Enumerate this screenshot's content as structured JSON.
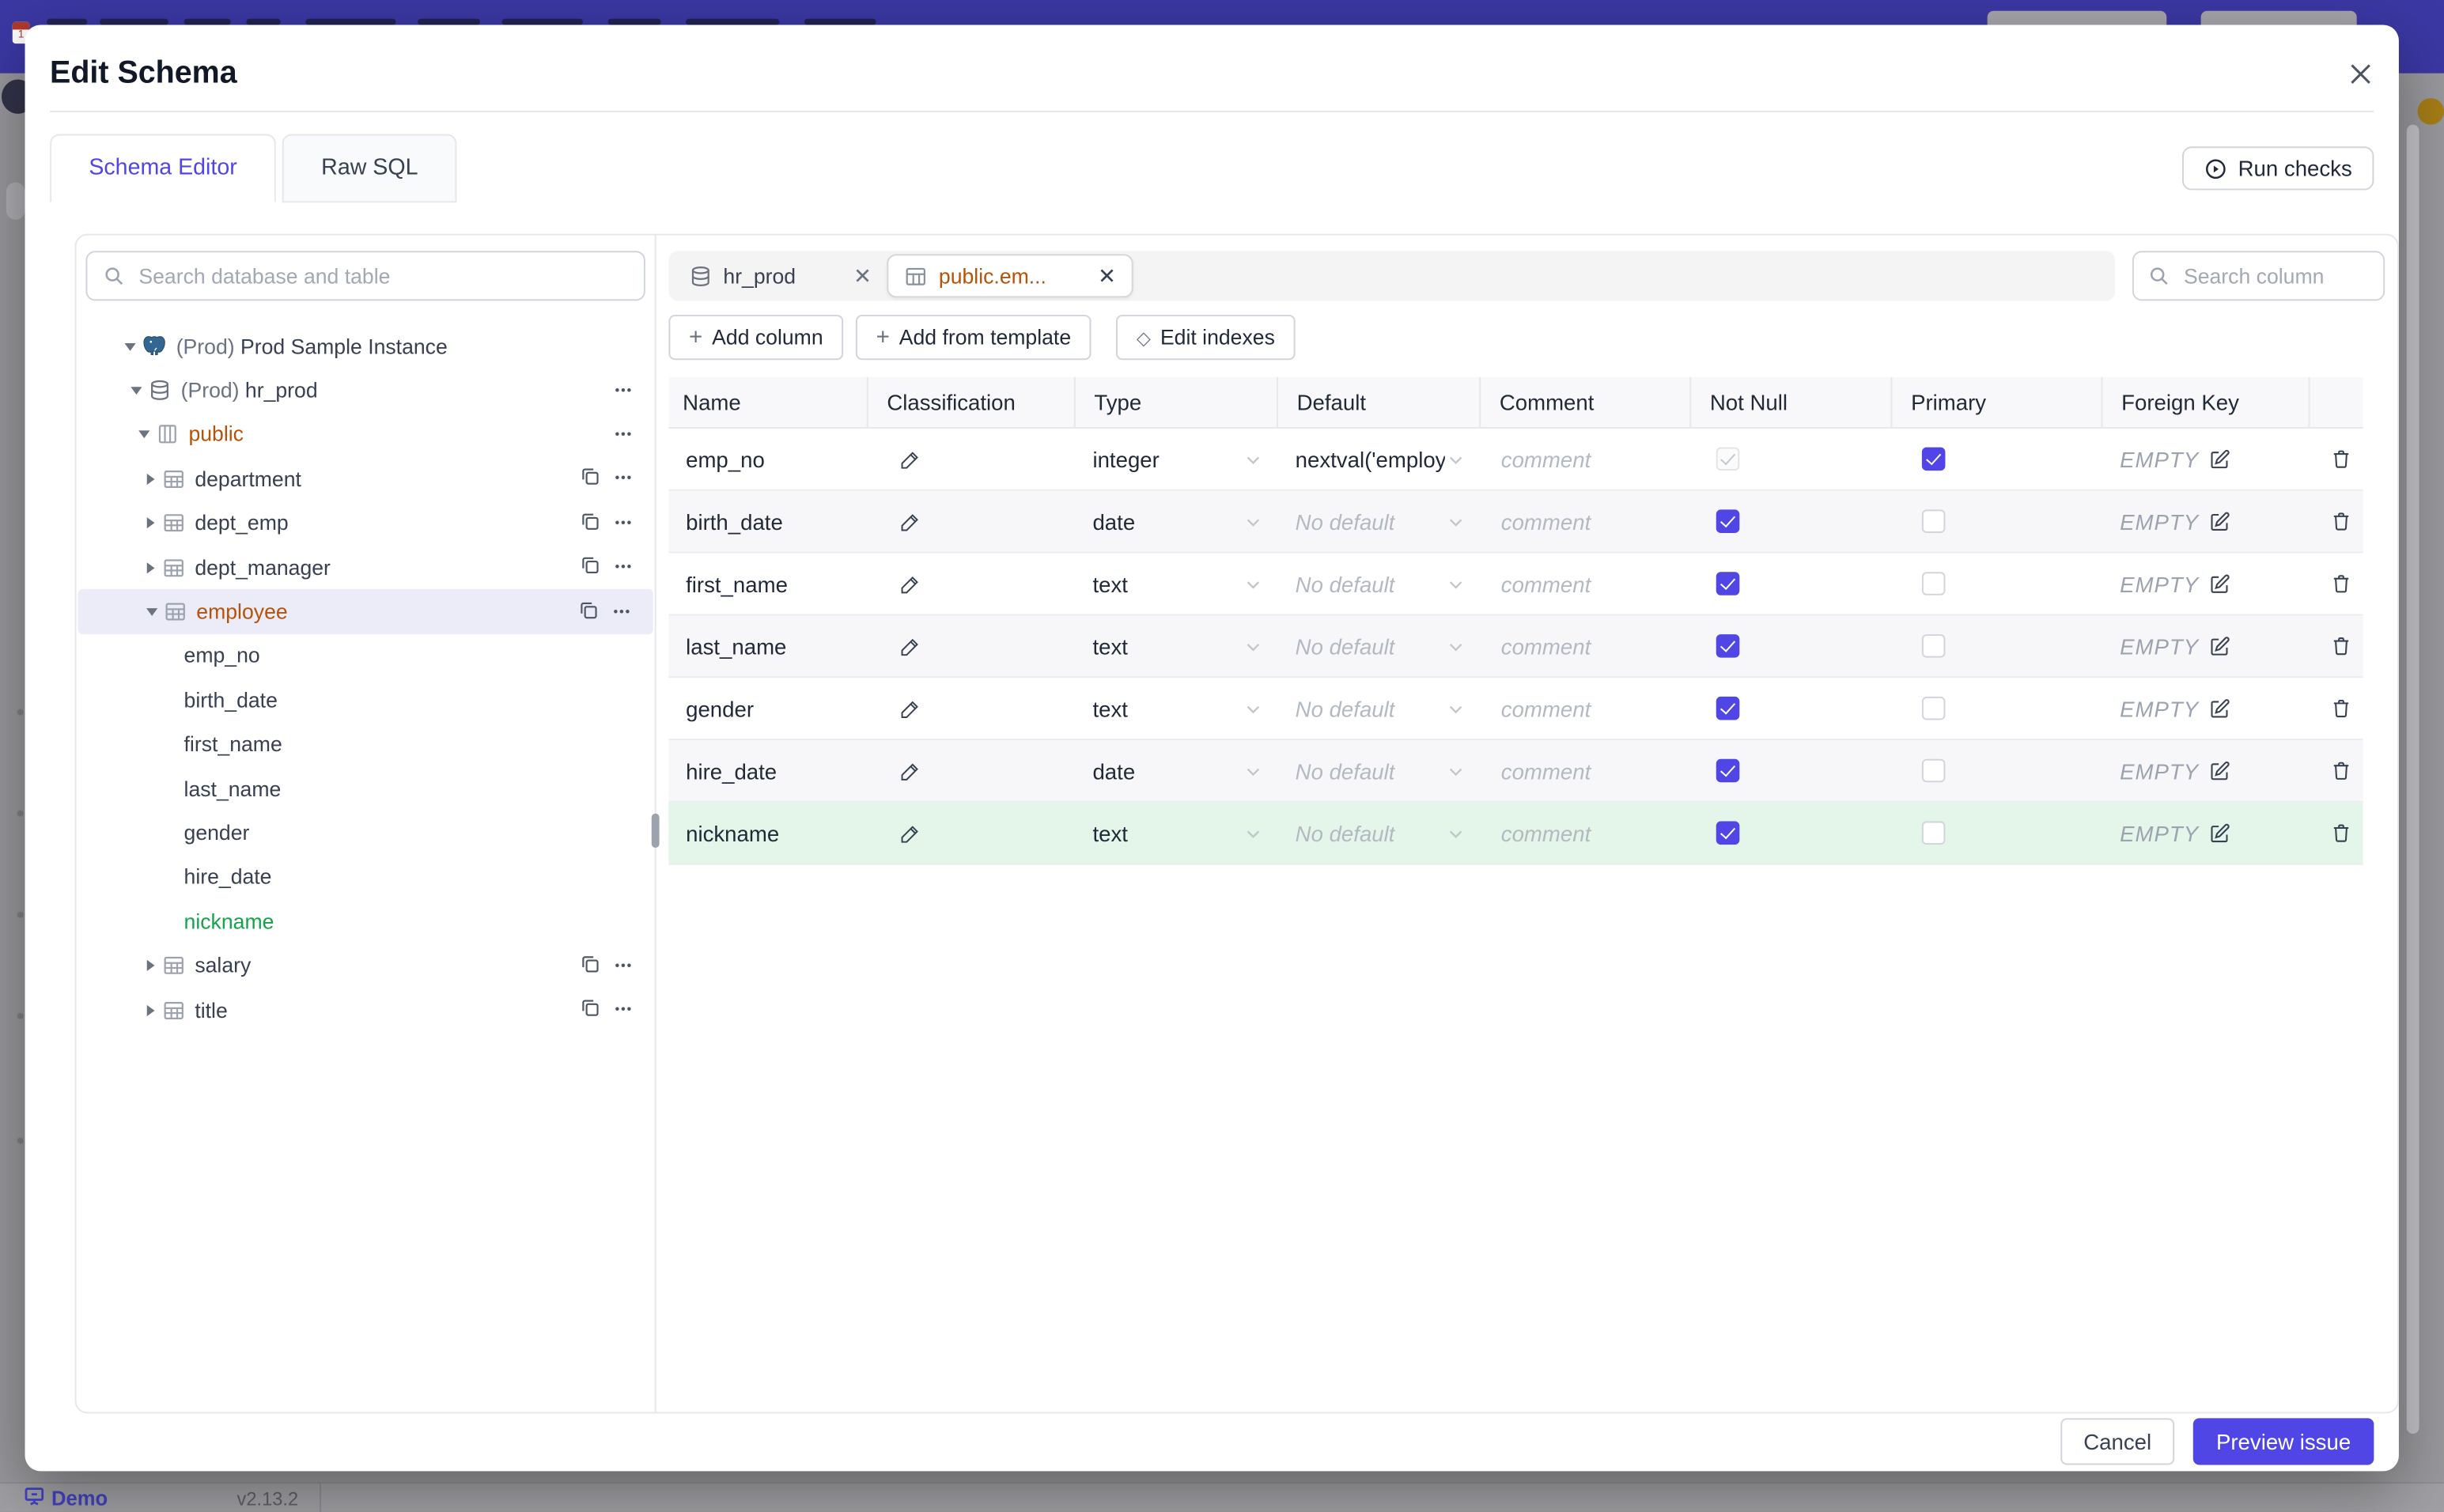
{
  "backdrop": {
    "header_color": "#3b38a4",
    "page_color": "#98989c",
    "footer": {
      "brand": "Demo",
      "version": "v2.13.2"
    }
  },
  "modal": {
    "title": "Edit Schema"
  },
  "tabs": [
    {
      "label": "Schema Editor",
      "active": true
    },
    {
      "label": "Raw SQL",
      "active": false
    }
  ],
  "run_checks": {
    "label": "Run checks"
  },
  "sidebar": {
    "search_placeholder": "Search database and table",
    "tree": [
      {
        "level": 0,
        "caret": "down",
        "icon": "postgres",
        "prefix": "(Prod) ",
        "label": "Prod Sample Instance",
        "color": "default",
        "actions": []
      },
      {
        "level": 1,
        "caret": "down",
        "icon": "database",
        "prefix": "(Prod) ",
        "label": "hr_prod",
        "color": "default",
        "actions": [
          "menu"
        ]
      },
      {
        "level": 2,
        "caret": "down",
        "icon": "schema",
        "prefix": "",
        "label": "public",
        "color": "amber",
        "actions": [
          "menu"
        ]
      },
      {
        "level": 3,
        "caret": "right",
        "icon": "table",
        "prefix": "",
        "label": "department",
        "color": "default",
        "actions": [
          "copy",
          "menu"
        ]
      },
      {
        "level": 3,
        "caret": "right",
        "icon": "table",
        "prefix": "",
        "label": "dept_emp",
        "color": "default",
        "actions": [
          "copy",
          "menu"
        ]
      },
      {
        "level": 3,
        "caret": "right",
        "icon": "table",
        "prefix": "",
        "label": "dept_manager",
        "color": "default",
        "actions": [
          "copy",
          "menu"
        ]
      },
      {
        "level": 3,
        "caret": "down",
        "icon": "table",
        "prefix": "",
        "label": "employee",
        "color": "amber",
        "selected": true,
        "actions": [
          "copy",
          "menu"
        ]
      },
      {
        "level": 4,
        "caret": null,
        "icon": null,
        "prefix": "",
        "label": "emp_no",
        "color": "default",
        "actions": []
      },
      {
        "level": 4,
        "caret": null,
        "icon": null,
        "prefix": "",
        "label": "birth_date",
        "color": "default",
        "actions": []
      },
      {
        "level": 4,
        "caret": null,
        "icon": null,
        "prefix": "",
        "label": "first_name",
        "color": "default",
        "actions": []
      },
      {
        "level": 4,
        "caret": null,
        "icon": null,
        "prefix": "",
        "label": "last_name",
        "color": "default",
        "actions": []
      },
      {
        "level": 4,
        "caret": null,
        "icon": null,
        "prefix": "",
        "label": "gender",
        "color": "default",
        "actions": []
      },
      {
        "level": 4,
        "caret": null,
        "icon": null,
        "prefix": "",
        "label": "hire_date",
        "color": "default",
        "actions": []
      },
      {
        "level": 4,
        "caret": null,
        "icon": null,
        "prefix": "",
        "label": "nickname",
        "color": "green",
        "actions": []
      },
      {
        "level": 3,
        "caret": "right",
        "icon": "table",
        "prefix": "",
        "label": "salary",
        "color": "default",
        "actions": [
          "copy",
          "menu"
        ]
      },
      {
        "level": 3,
        "caret": "right",
        "icon": "table",
        "prefix": "",
        "label": "title",
        "color": "default",
        "actions": [
          "copy",
          "menu"
        ]
      }
    ]
  },
  "main": {
    "chips": [
      {
        "label": "hr_prod",
        "icon": "database",
        "active": false
      },
      {
        "label": "public.em...",
        "icon": "table",
        "active": true
      }
    ],
    "column_search_placeholder": "Search column",
    "toolbar": [
      {
        "icon": "+",
        "label": "Add column"
      },
      {
        "icon": "+",
        "label": "Add from template"
      },
      {
        "icon": "◇",
        "label": "Edit indexes"
      }
    ],
    "table": {
      "headers": [
        "Name",
        "Classification",
        "Type",
        "Default",
        "Comment",
        "Not Null",
        "Primary",
        "Foreign Key",
        ""
      ],
      "comment_placeholder": "comment",
      "no_default_text": "No default",
      "fk_empty_text": "EMPTY",
      "rows": [
        {
          "name": "emp_no",
          "type": "integer",
          "default": "nextval('employ",
          "default_is_placeholder": false,
          "not_null": "disabled-checked",
          "primary": true,
          "highlight": null
        },
        {
          "name": "birth_date",
          "type": "date",
          "default": "No default",
          "default_is_placeholder": true,
          "not_null": "checked",
          "primary": false,
          "highlight": null
        },
        {
          "name": "first_name",
          "type": "text",
          "default": "No default",
          "default_is_placeholder": true,
          "not_null": "checked",
          "primary": false,
          "highlight": null
        },
        {
          "name": "last_name",
          "type": "text",
          "default": "No default",
          "default_is_placeholder": true,
          "not_null": "checked",
          "primary": false,
          "highlight": null
        },
        {
          "name": "gender",
          "type": "text",
          "default": "No default",
          "default_is_placeholder": true,
          "not_null": "checked",
          "primary": false,
          "highlight": null
        },
        {
          "name": "hire_date",
          "type": "date",
          "default": "No default",
          "default_is_placeholder": true,
          "not_null": "checked",
          "primary": false,
          "highlight": null
        },
        {
          "name": "nickname",
          "type": "text",
          "default": "No default",
          "default_is_placeholder": true,
          "not_null": "checked",
          "primary": false,
          "highlight": "green"
        }
      ]
    }
  },
  "footer": {
    "cancel": "Cancel",
    "submit": "Preview issue"
  },
  "colors": {
    "accent": "#4f46e5",
    "amber": "#b45309",
    "green": "#16a34a",
    "green_row": "#e3f6e9",
    "selected_row": "#ececf9"
  }
}
